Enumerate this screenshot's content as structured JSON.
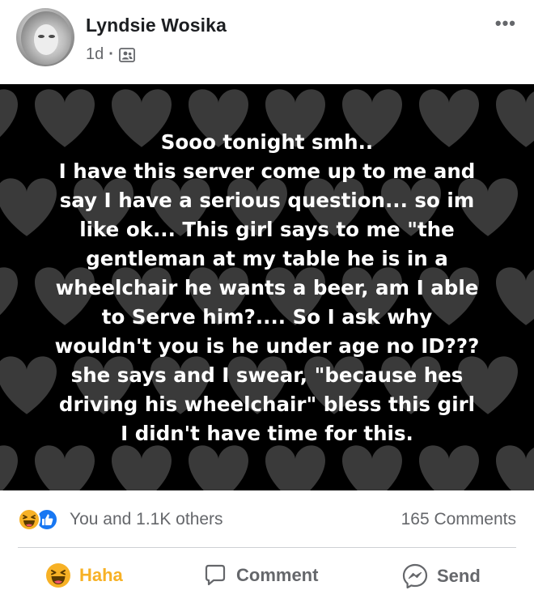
{
  "post": {
    "author": "Lyndsie Wosika",
    "time": "1d",
    "separator": "·",
    "audience_icon": "friends-icon",
    "more_label": "•••",
    "text": "Sooo tonight smh..\nI have this server come up to me and\nsay I have a serious question... so im\nlike ok... This girl says to me \"the\ngentleman at my table he is in a\nwheelchair he wants a beer, am I able\nto  Serve him?....  So I ask why\nwouldn't you is he under age no ID???\nshe says and I swear, \"because hes\ndriving his wheelchair\" bless this girl\nI didn't have time for this.",
    "background_color": "#000000",
    "heart_color": "#3a3a3a"
  },
  "stats": {
    "reactions_text": "You and 1.1K others",
    "comments_text": "165 Comments",
    "reaction_icons": [
      "haha-icon",
      "like-icon"
    ]
  },
  "actions": {
    "haha_label": "Haha",
    "comment_label": "Comment",
    "send_label": "Send"
  },
  "colors": {
    "haha_accent": "#f7b125",
    "like_blue": "#1877f2",
    "muted_text": "#65676b"
  }
}
